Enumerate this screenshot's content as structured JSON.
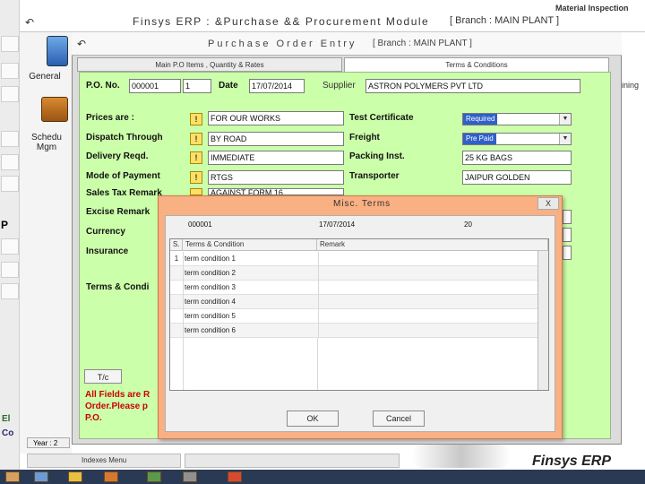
{
  "outer_window": {
    "title": "Finsys ERP : &Purchase && Procurement Module",
    "branch": "[ Branch : MAIN PLANT ]",
    "right_label": "Material Inspection",
    "right_label_2": "ining",
    "left_icons": [
      {
        "label": "General",
        "icon": "blue-figure-icon"
      },
      {
        "label": "Schedu Mgm",
        "icon": "briefcase-icon"
      }
    ],
    "bottom_tab": "Year : 2",
    "bottom_item": "Indexes Menu",
    "left_letters": [
      "P",
      "El",
      "Co"
    ],
    "logo_text": "Finsys ERP"
  },
  "inner_window": {
    "title": "Purchase Order Entry",
    "branch": "[ Branch : MAIN PLANT ]",
    "tabs": [
      {
        "label": "Main P.O Items , Quantity & Rates",
        "active": false
      },
      {
        "label": "Terms & Conditions",
        "active": true
      }
    ]
  },
  "header_row": {
    "po_no_label": "P.O. No.",
    "po_no_value": "000001",
    "po_suffix": "1",
    "date_label": "Date",
    "date_value": "17/07/2014",
    "supplier_label": "Supplier",
    "supplier_value": "ASTRON POLYMERS PVT LTD"
  },
  "left_fields": [
    {
      "label": "Prices are :",
      "value": "FOR OUR WORKS"
    },
    {
      "label": "Dispatch Through",
      "value": "BY ROAD"
    },
    {
      "label": "Delivery Reqd.",
      "value": "IMMEDIATE"
    },
    {
      "label": "Mode of Payment",
      "value": "RTGS"
    },
    {
      "label": "Sales Tax Remark",
      "value": "AGAINST FORM 16"
    },
    {
      "label": "Excise Remark",
      "value": ""
    },
    {
      "label": "Currency",
      "value": ""
    },
    {
      "label": "Insurance",
      "value": ""
    },
    {
      "label": "Terms & Condi",
      "value": ""
    }
  ],
  "right_fields": [
    {
      "label": "Test Certificate",
      "value": "Required",
      "type": "select"
    },
    {
      "label": "Freight",
      "value": "Pre Paid",
      "type": "select"
    },
    {
      "label": "Packing Inst.",
      "value": "25 KG BAGS",
      "type": "text"
    },
    {
      "label": "Transporter",
      "value": "JAIPUR GOLDEN",
      "type": "text"
    }
  ],
  "terms_button": "T/c",
  "notice": {
    "line1": "All Fields are R",
    "line2": "Order.Please p",
    "line3": "P.O."
  },
  "dialog": {
    "title": "Misc. Terms",
    "close_label": "X",
    "info_po": "000001",
    "info_date": "17/07/2014",
    "info_code": "20",
    "columns": [
      "S.",
      "Terms & Condition",
      "Remark"
    ],
    "rows": [
      {
        "sno": "1",
        "term": "term condition 1",
        "remark": ""
      },
      {
        "sno": "",
        "term": "term condition 2",
        "remark": ""
      },
      {
        "sno": "",
        "term": "term condition 3",
        "remark": ""
      },
      {
        "sno": "",
        "term": "term condition 4",
        "remark": ""
      },
      {
        "sno": "",
        "term": "term condition 5",
        "remark": ""
      },
      {
        "sno": "",
        "term": "term condition 6",
        "remark": ""
      }
    ],
    "ok_label": "OK",
    "cancel_label": "Cancel"
  },
  "colors": {
    "form_bg": "#ccffaa",
    "dialog_bg": "#f9b083",
    "select_highlight": "#3060c8",
    "notice_red": "#cc0000"
  }
}
